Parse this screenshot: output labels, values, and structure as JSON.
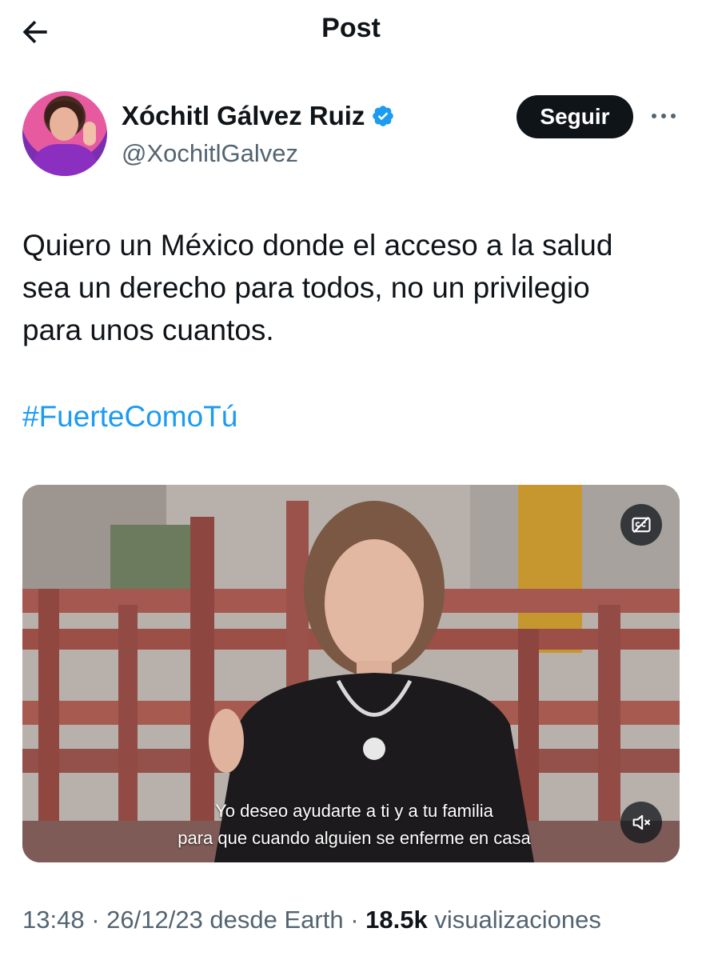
{
  "header": {
    "title": "Post",
    "back_icon": "arrow-left-icon"
  },
  "author": {
    "name": "Xóchitl Gálvez Ruiz",
    "handle": "@XochitlGalvez",
    "verified_icon": "verified-badge-icon",
    "follow_label": "Seguir",
    "more_icon": "more-horizontal-icon"
  },
  "post": {
    "text": "Quiero un México donde el acceso a la salud\nsea un derecho para todos, no un privilegio\npara unos cuantos.",
    "hashtag": "#FuerteComoTú"
  },
  "video": {
    "caption_line1": "Yo deseo ayudarte a ti y a tu familia",
    "caption_line2": "para que cuando alguien se enferme en casa",
    "cc_icon": "closed-captions-icon",
    "mute_icon": "volume-muted-icon"
  },
  "meta": {
    "time": "13:48",
    "sep1": " · ",
    "date": "26/12/23",
    "source": " desde Earth",
    "sep2": " · ",
    "views_count": "18.5k",
    "views_label": " visualizaciones"
  },
  "colors": {
    "link": "#1d9bf0",
    "verified": "#1d9bf0",
    "text": "#0f1419",
    "secondary": "#536471"
  }
}
